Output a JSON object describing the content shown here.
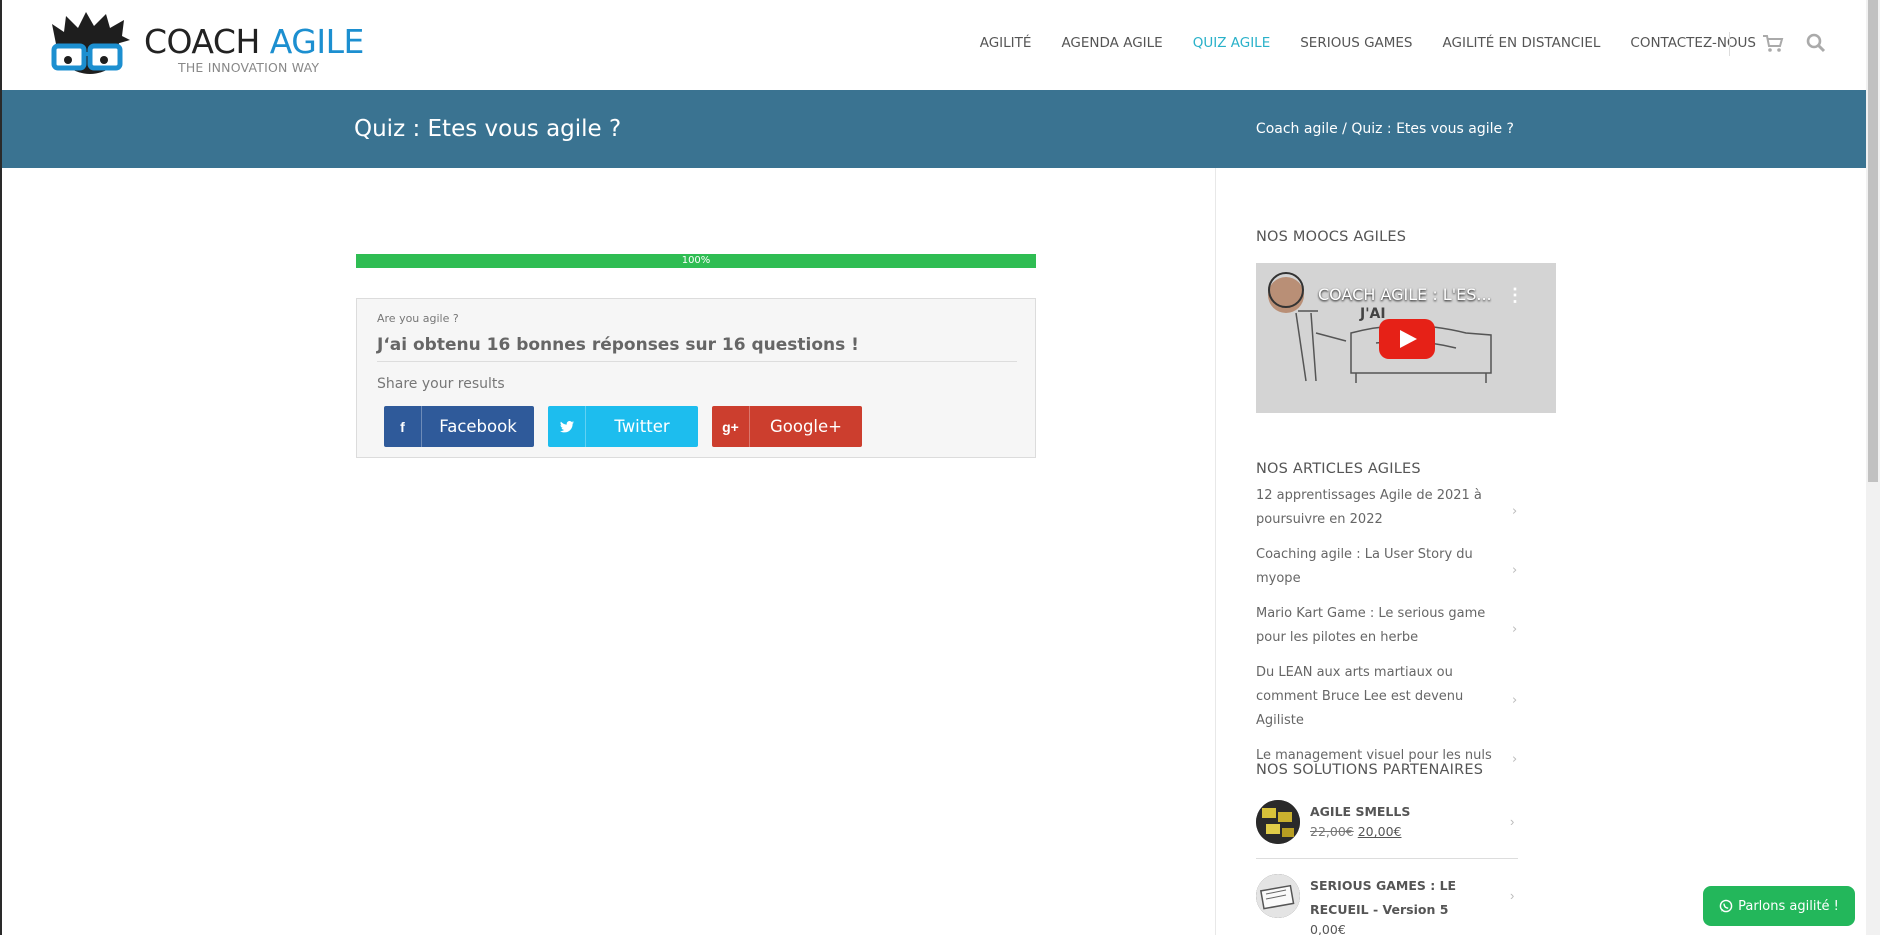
{
  "header": {
    "logo_main": "COACH ",
    "logo_accent": "AGILE",
    "logo_tagline": "THE INNOVATION WAY",
    "nav": [
      {
        "label": "AGILITÉ"
      },
      {
        "label": "AGENDA AGILE"
      },
      {
        "label": "QUIZ AGILE",
        "active": true
      },
      {
        "label": "SERIOUS GAMES"
      },
      {
        "label": "AGILITÉ EN DISTANCIEL"
      },
      {
        "label": "CONTACTEZ-NOUS"
      }
    ],
    "icons": [
      "cart-icon",
      "search-icon"
    ]
  },
  "titlebar": {
    "title": "Quiz : Etes vous agile ?",
    "breadcrumb": "Coach agile / Quiz : Etes vous agile ?"
  },
  "quiz": {
    "progress_label": "100%",
    "progress_value": 1.0,
    "quiz_name": "Are you agile ?",
    "result": "J‘ai obtenu 16 bonnes réponses sur 16 questions !",
    "share_label": "Share your results",
    "share": {
      "facebook": {
        "icon": "f",
        "label": "Facebook"
      },
      "twitter": {
        "icon": "twitter-icon",
        "label": "Twitter"
      },
      "google": {
        "icon": "g+",
        "label": "Google+"
      }
    }
  },
  "sidebar": {
    "moocs_title": "NOS MOOCS AGILES",
    "video_title": "COACH AGILE : L'ES...",
    "articles_title": "NOS ARTICLES AGILES",
    "articles": [
      "12 apprentissages Agile de 2021 à poursuivre en 2022",
      "Coaching agile : La User Story du myope",
      "Mario Kart Game : Le serious game pour les pilotes en herbe",
      "Du LEAN aux arts martiaux ou comment Bruce Lee est devenu Agiliste",
      "Le management visuel pour les nuls"
    ],
    "partners_title": "NOS SOLUTIONS PARTENAIRES",
    "partners": [
      {
        "name": "AGILE SMELLS",
        "old_price": "22,00€",
        "price": "20,00€"
      },
      {
        "name": "SERIOUS GAMES : LE RECUEIL - Version 5",
        "price": "0,00€"
      }
    ]
  },
  "chat": {
    "label": "Parlons agilité !"
  },
  "colors": {
    "accent": "#29b1c9",
    "titlebar": "#3a7391",
    "progress": "#2fbd53",
    "facebook": "#2f5a9a",
    "twitter": "#1dbdee",
    "google": "#cc3e2e",
    "chat": "#23b75b"
  }
}
